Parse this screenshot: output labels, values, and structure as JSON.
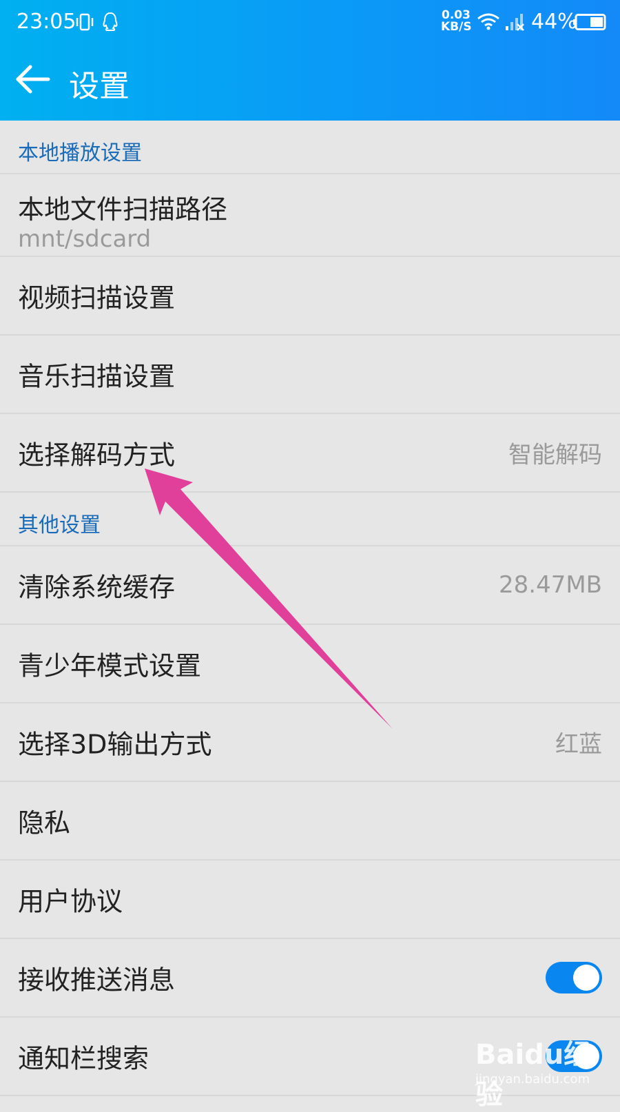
{
  "status_bar": {
    "time": "23:05",
    "net_speed_value": "0.03",
    "net_speed_unit": "KB/S",
    "battery": "44%",
    "icons": [
      "vibrate-icon",
      "qq-icon",
      "wifi-icon",
      "signal-icon",
      "battery-icon"
    ]
  },
  "header": {
    "title": "设置",
    "back_icon": "back-arrow-icon",
    "gradient": [
      "#00b0f0",
      "#138af8"
    ]
  },
  "sections": {
    "local": {
      "header": "本地播放设置",
      "scan_path_label": "本地文件扫描路径",
      "scan_path_value": "mnt/sdcard",
      "video_scan": "视频扫描设置",
      "music_scan": "音乐扫描设置",
      "decode_label": "选择解码方式",
      "decode_value": "智能解码"
    },
    "other": {
      "header": "其他设置",
      "cache_label": "清除系统缓存",
      "cache_value": "28.47MB",
      "teen_mode": "青少年模式设置",
      "output3d_label": "选择3D输出方式",
      "output3d_value": "红蓝",
      "privacy": "隐私",
      "agreement": "用户协议",
      "push_label": "接收推送消息",
      "push_on": true,
      "notify_search_label": "通知栏搜索",
      "notify_search_on": true
    }
  },
  "colors": {
    "accent": "#0a86f0",
    "section_header": "#1a6bb8",
    "annotation_arrow": "#e0409a"
  },
  "watermark": {
    "main": "Baidu经验",
    "sub": "jingyan.baidu.com"
  }
}
